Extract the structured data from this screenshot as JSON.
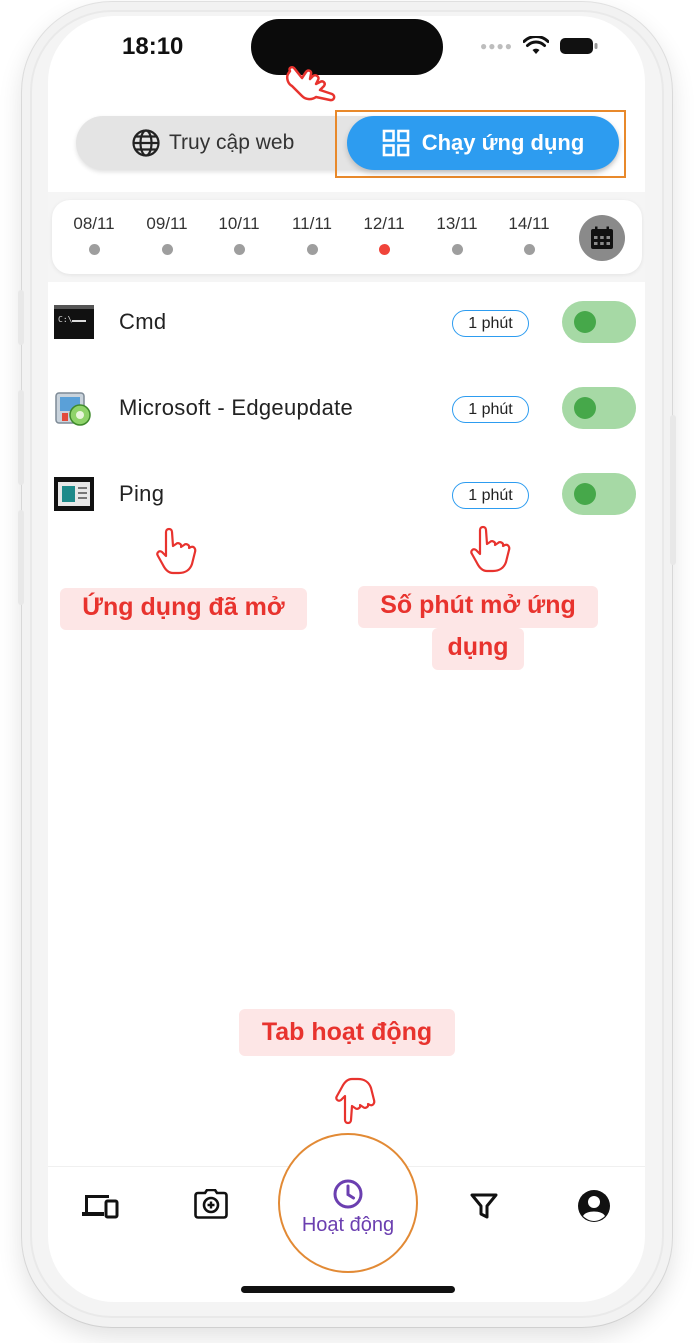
{
  "status_bar": {
    "time": "18:10"
  },
  "mode_switch": {
    "web_label": "Truy cập web",
    "app_label": "Chạy ứng dụng",
    "active": "app"
  },
  "dates": {
    "items": [
      "08/11",
      "09/11",
      "10/11",
      "11/11",
      "12/11",
      "13/11",
      "14/11"
    ],
    "selected": "12/11",
    "calendar_icon": "calendar-icon"
  },
  "apps": [
    {
      "name": "Cmd",
      "duration": "1 phút",
      "enabled": true,
      "icon": "cmd-icon"
    },
    {
      "name": "Microsoft - Edgeupdate",
      "duration": "1 phút",
      "enabled": true,
      "icon": "edgeupdate-icon"
    },
    {
      "name": "Ping",
      "duration": "1 phút",
      "enabled": true,
      "icon": "ping-icon"
    }
  ],
  "annotations": {
    "apps_opened": "Ứng dụng đã mở",
    "minutes_line1": "Số phút mở ứng",
    "minutes_line2": "dụng",
    "activity_tab": "Tab hoạt động"
  },
  "bottom_nav": {
    "items": [
      "devices-icon",
      "camera-icon",
      "clock-icon",
      "filter-icon",
      "account-icon"
    ],
    "active_label": "Hoạt động"
  },
  "colors": {
    "accent_blue": "#2d9cf0",
    "toggle_on": "#a6d9a5",
    "callout_text": "#e8332e",
    "active_tab": "#6b3fb0",
    "highlight_orange": "#e8892b"
  }
}
